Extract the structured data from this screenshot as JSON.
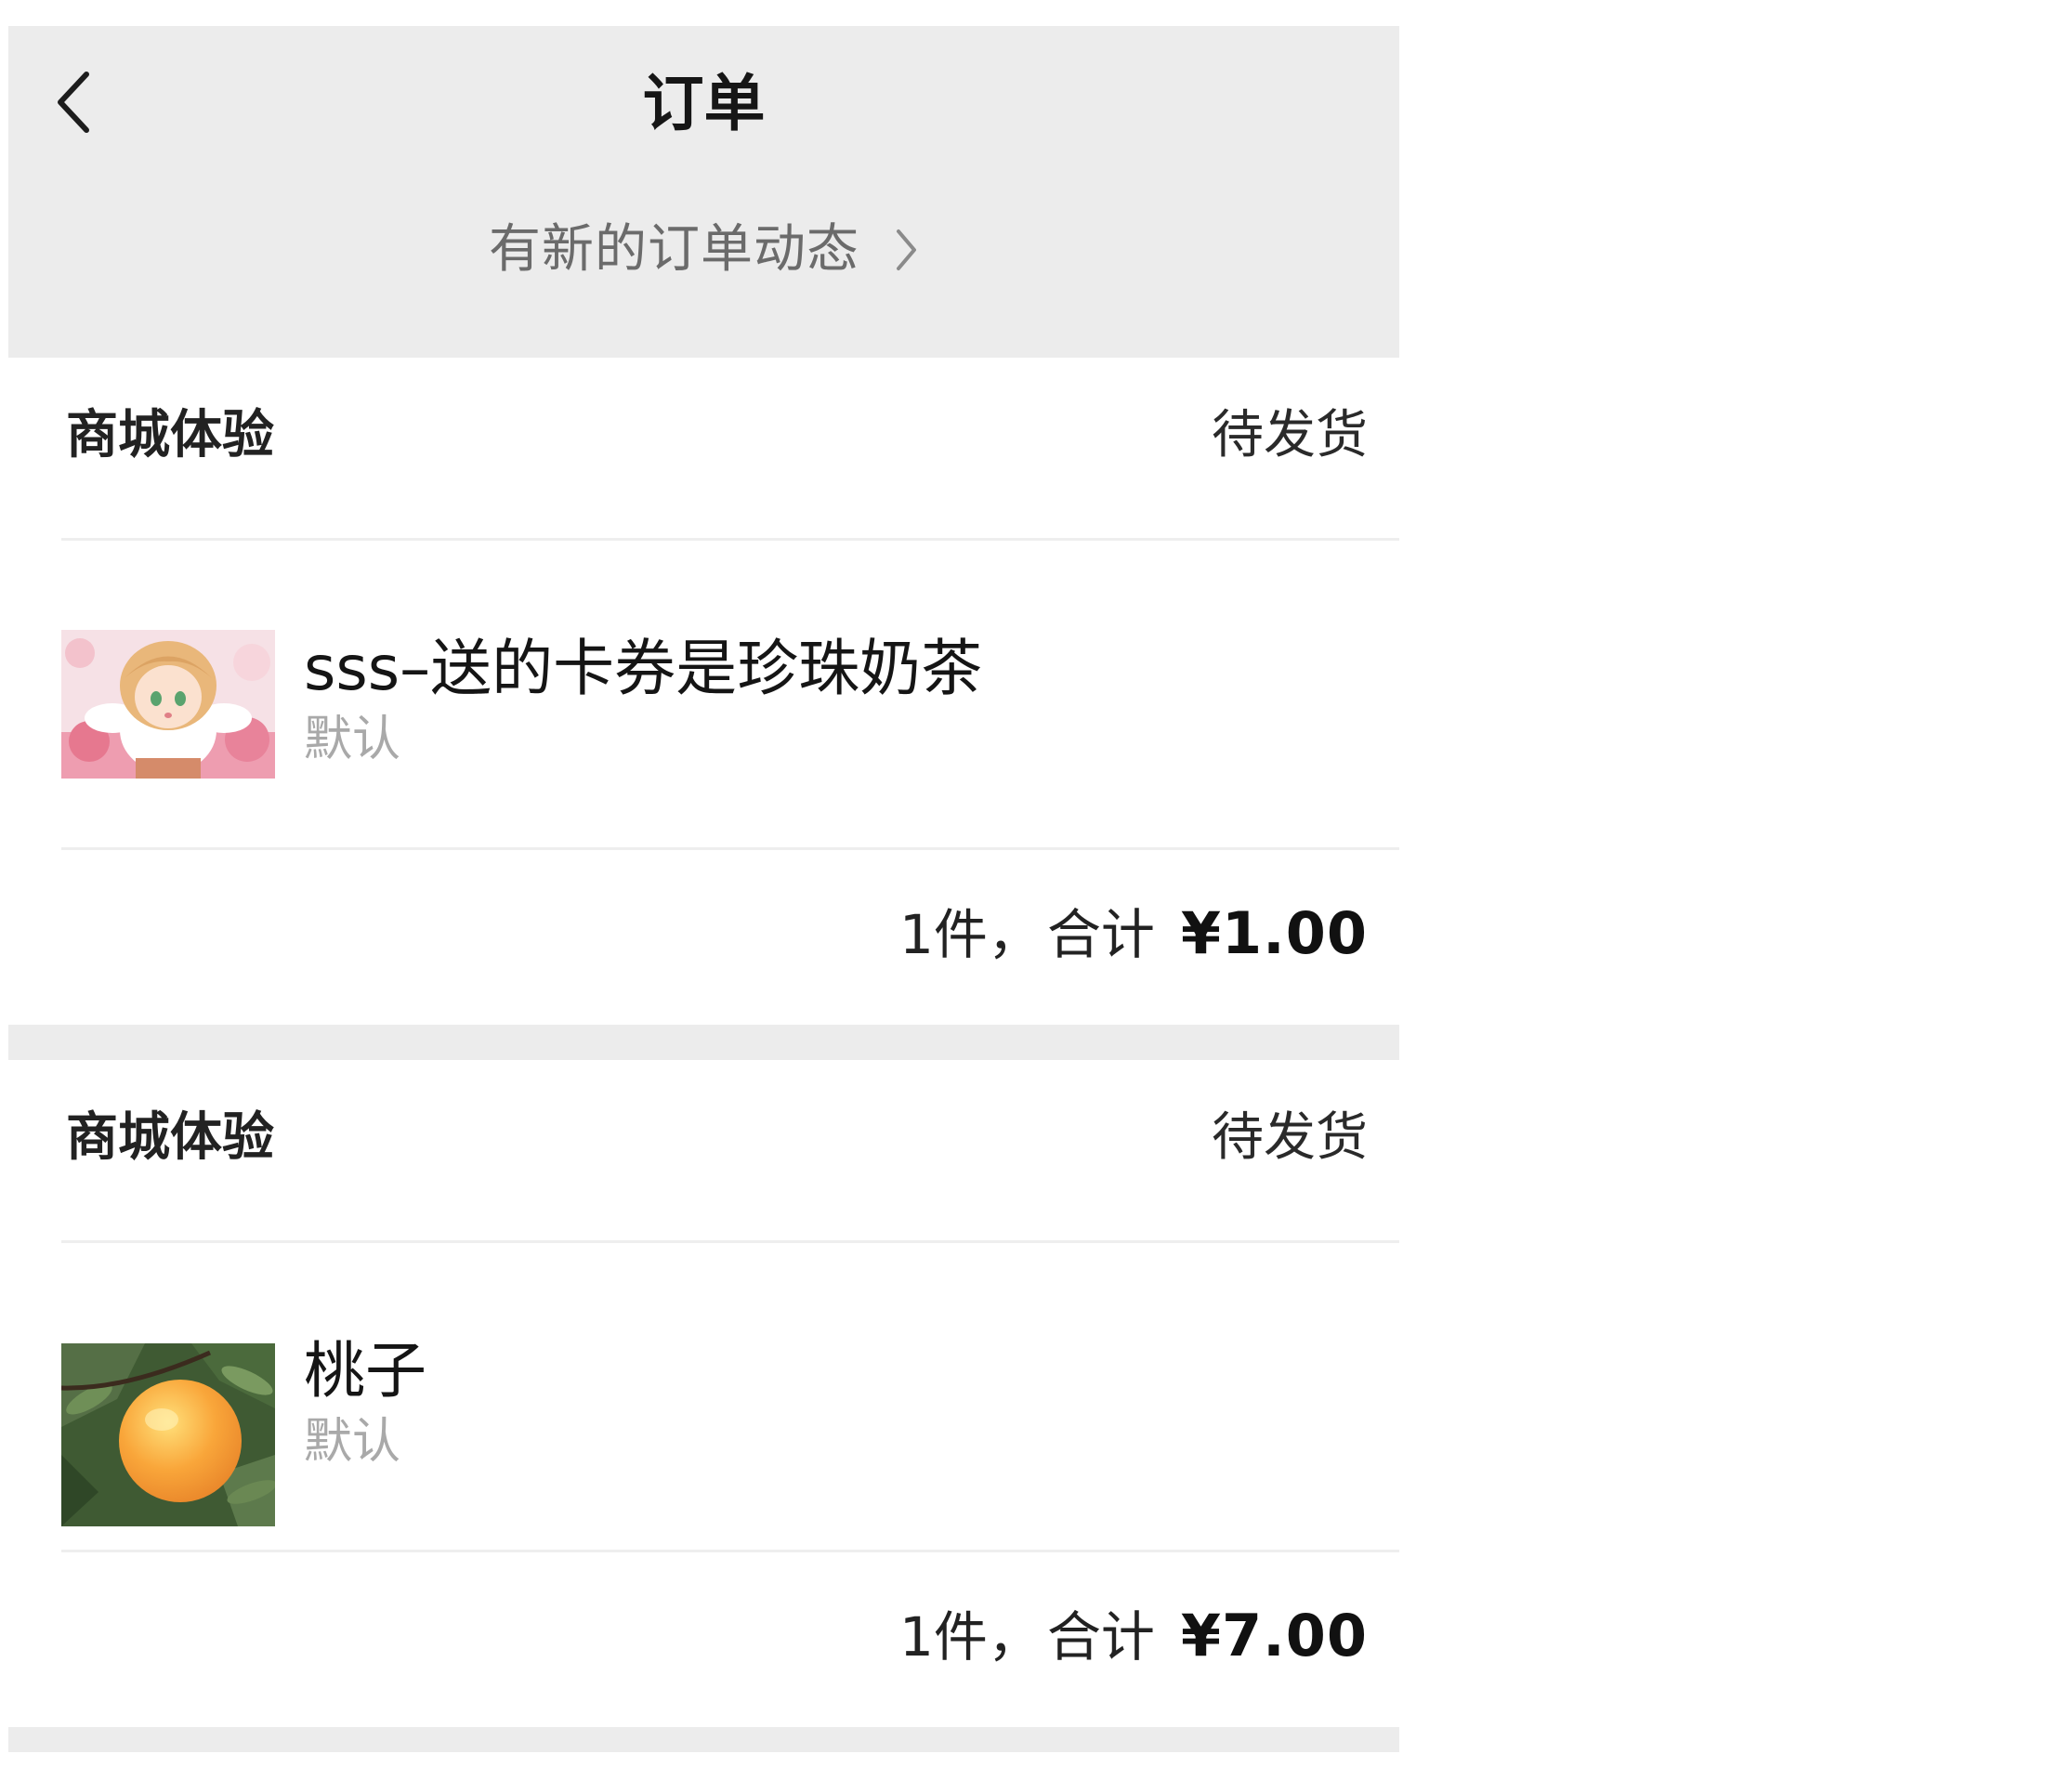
{
  "header": {
    "title": "订单",
    "back_icon": "chevron-left-icon",
    "notice": "有新的订单动态",
    "notice_icon": "chevron-right-icon",
    "background": "#ececec"
  },
  "orders": [
    {
      "shop": "商城体验",
      "status": "待发货",
      "item": {
        "name": "sss–送的卡券是珍珠奶茶",
        "spec": "默认",
        "image": "anime-girl-thumbnail"
      },
      "count": "1件，",
      "total_label": "合计",
      "total": "¥1.00"
    },
    {
      "shop": "商城体验",
      "status": "待发货",
      "item": {
        "name": "桃子",
        "spec": "默认",
        "image": "peach-thumbnail"
      },
      "count": "1件，",
      "total_label": "合计",
      "total": "¥7.00"
    }
  ]
}
